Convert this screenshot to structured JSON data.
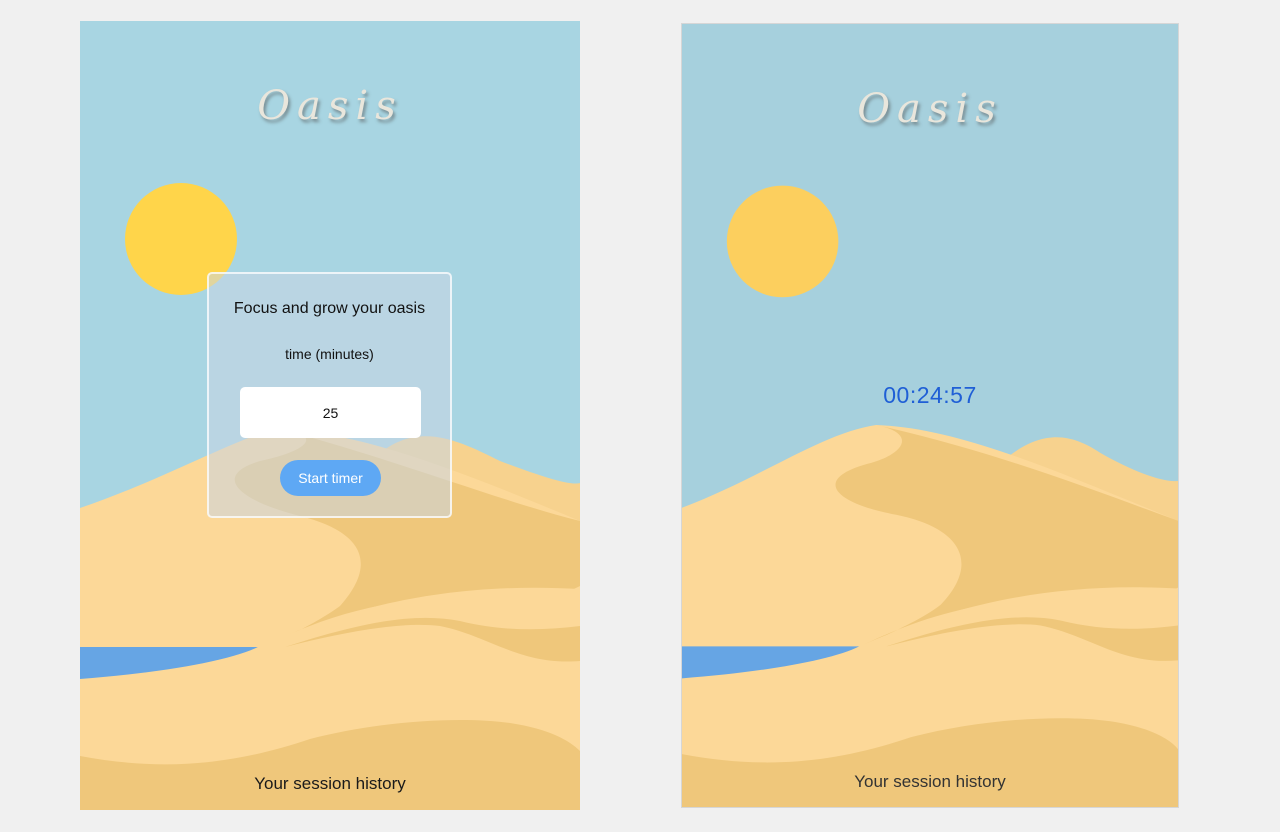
{
  "colors": {
    "page_background": "#f0f0f0",
    "sky": "#a8d5e2",
    "sky_dim": "#a6d0dd",
    "sun": "#ffd54a",
    "sun_dim": "#fccf5e",
    "dune_light": "#fcd898",
    "dune_mid": "#f7d28e",
    "dune_dark": "#efc77b",
    "water": "#66a5e4",
    "accent_button": "#5ea8f4",
    "timer_text": "#1f5fd6"
  },
  "start_screen": {
    "app_title": "Oasis",
    "card": {
      "heading": "Focus and grow your oasis",
      "time_label": "time (minutes)",
      "minutes_value": "25",
      "start_button_label": "Start timer"
    },
    "history_label": "Your session history"
  },
  "timer_screen": {
    "app_title": "Oasis",
    "timer_text": "00:24:57",
    "history_label": "Your session history"
  }
}
